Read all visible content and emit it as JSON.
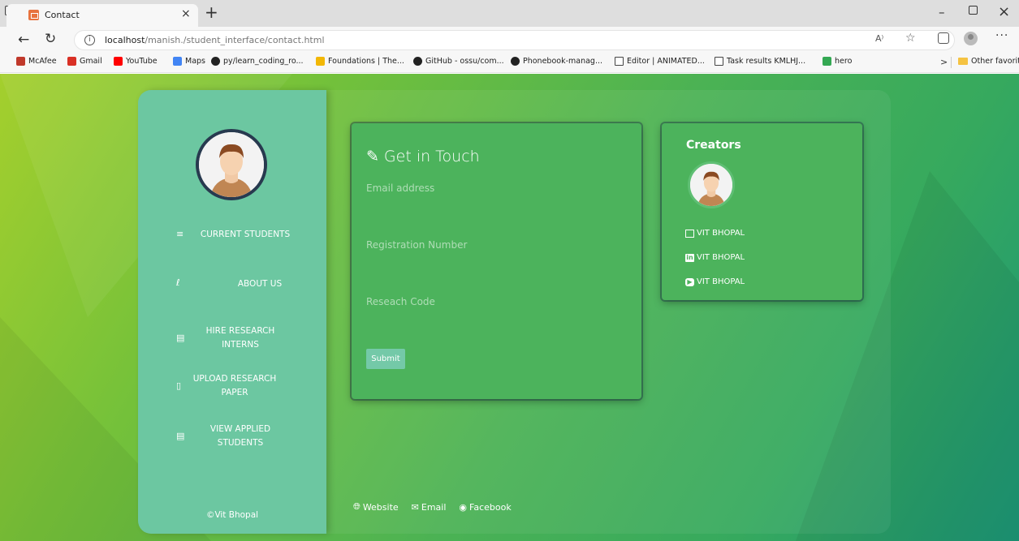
{
  "browser": {
    "tab_title": "Contact",
    "tab_close": "×",
    "new_tab": "+",
    "url_host": "localhost",
    "url_path": "/manish./student_interface/contact.html",
    "read_aloud": "A⁾",
    "window_minimize": "–",
    "window_close": "×",
    "more": "···",
    "favorites": [
      {
        "label": "McAfee",
        "icon": "mcafee-icon",
        "color": "#c0392b"
      },
      {
        "label": "Gmail",
        "icon": "gmail-icon",
        "color": "#d93025"
      },
      {
        "label": "YouTube",
        "icon": "youtube-icon",
        "color": "#ff0000"
      },
      {
        "label": "Maps",
        "icon": "google-icon",
        "color": "#4285f4"
      },
      {
        "label": "py/learn_coding_ro...",
        "icon": "github-icon",
        "color": "#222222"
      },
      {
        "label": "Foundations | The...",
        "icon": "foundations-icon",
        "color": "#f2b705"
      },
      {
        "label": "GitHub - ossu/com...",
        "icon": "github-icon",
        "color": "#222222"
      },
      {
        "label": "Phonebook-manag...",
        "icon": "github-icon",
        "color": "#222222"
      },
      {
        "label": "Editor | ANIMATED...",
        "icon": "page-icon",
        "color": "#ffffff"
      },
      {
        "label": "Task results KMLHJ...",
        "icon": "page-icon",
        "color": "#ffffff"
      },
      {
        "label": "hero",
        "icon": "pinwheel-icon",
        "color": "#34a853"
      }
    ],
    "favorites_more": ">",
    "other_favorites": "Other favorites"
  },
  "sidebar": {
    "items": [
      {
        "label": "CURRENT STUDENTS",
        "icon": "list-icon"
      },
      {
        "label": "ABOUT US",
        "icon": "info-icon"
      },
      {
        "label": "HIRE RESEARCH INTERNS",
        "icon": "id-card-icon"
      },
      {
        "label": "UPLOAD RESEARCH PAPER",
        "icon": "file-icon"
      },
      {
        "label": "VIEW APPLIED STUDENTS",
        "icon": "id-card-icon"
      }
    ],
    "footer": "©Vit Bhopal"
  },
  "contact_form": {
    "title": "Get in Touch",
    "email_placeholder": "Email address",
    "registration_placeholder": "Registration Number",
    "research_code_placeholder": "Reseach Code",
    "submit_label": "Submit"
  },
  "creators": {
    "title": "Creators",
    "links": [
      {
        "label": "VIT BHOPAL",
        "icon": "mail-icon"
      },
      {
        "label": "VIT BHOPAL",
        "icon": "linkedin-icon"
      },
      {
        "label": "VIT BHOPAL",
        "icon": "youtube-icon"
      }
    ]
  },
  "footer": {
    "website": "Website",
    "email": "Email",
    "facebook": "Facebook"
  },
  "colors": {
    "gradient_start": "#a4cf2d",
    "gradient_end": "#1c9676",
    "sidebar": "#6cc7a1",
    "card": "#4cb35c",
    "avatar_ring": "#283a4f"
  }
}
